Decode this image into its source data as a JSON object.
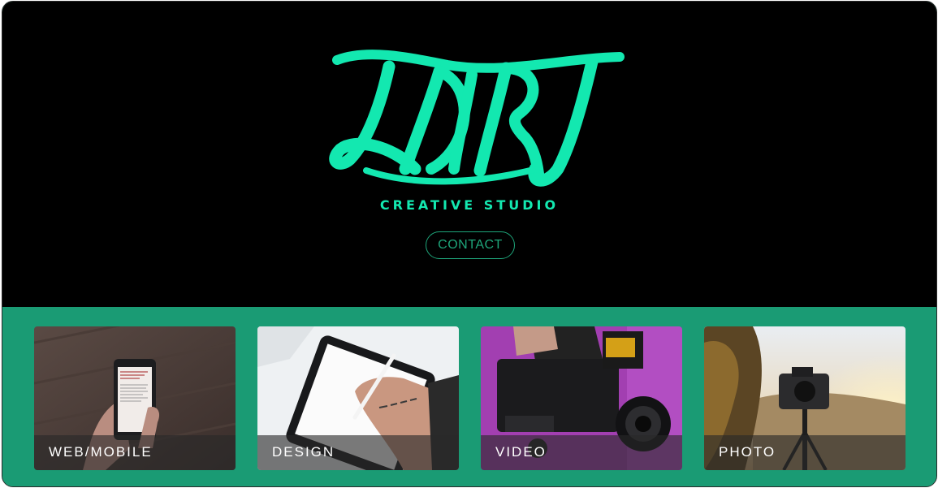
{
  "hero": {
    "logo_text": "LARJ",
    "tagline": "CREATIVE STUDIO",
    "contact_label": "CONTACT"
  },
  "services": [
    {
      "label": "WEB/MOBILE"
    },
    {
      "label": "DESIGN"
    },
    {
      "label": "VIDEO"
    },
    {
      "label": "PHOTO"
    }
  ],
  "colors": {
    "brand_accent": "#13e8b0",
    "section_green": "#1a9b74",
    "hero_background": "#000000",
    "contact_outline": "#1ea57a"
  }
}
